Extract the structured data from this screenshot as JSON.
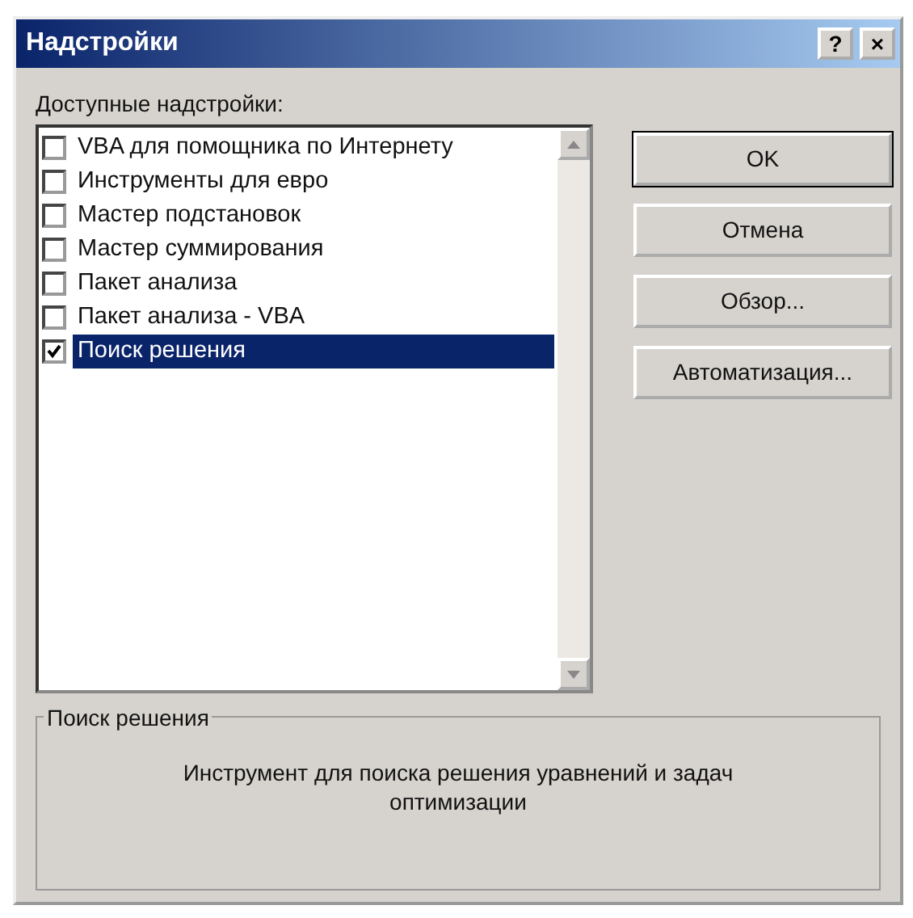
{
  "window": {
    "title": "Надстройки",
    "title_buttons": [
      "?",
      "×"
    ]
  },
  "list_label": "Доступные надстройки:",
  "addins": [
    {
      "label": "VBA для помощника по Интернету",
      "checked": false,
      "selected": false
    },
    {
      "label": "Инструменты для евро",
      "checked": false,
      "selected": false
    },
    {
      "label": "Мастер подстановок",
      "checked": false,
      "selected": false
    },
    {
      "label": "Мастер суммирования",
      "checked": false,
      "selected": false
    },
    {
      "label": "Пакет анализа",
      "checked": false,
      "selected": false
    },
    {
      "label": "Пакет анализа - VBA",
      "checked": false,
      "selected": false
    },
    {
      "label": "Поиск решения",
      "checked": true,
      "selected": true
    }
  ],
  "buttons": [
    {
      "label": "OK",
      "default": true
    },
    {
      "label": "Отмена",
      "default": false
    },
    {
      "label": "Обзор...",
      "default": false
    },
    {
      "label": "Автоматизация...",
      "default": false
    }
  ],
  "description": {
    "title": "Поиск решения",
    "text": "Инструмент для поиска решения уравнений и задач оптимизации"
  }
}
